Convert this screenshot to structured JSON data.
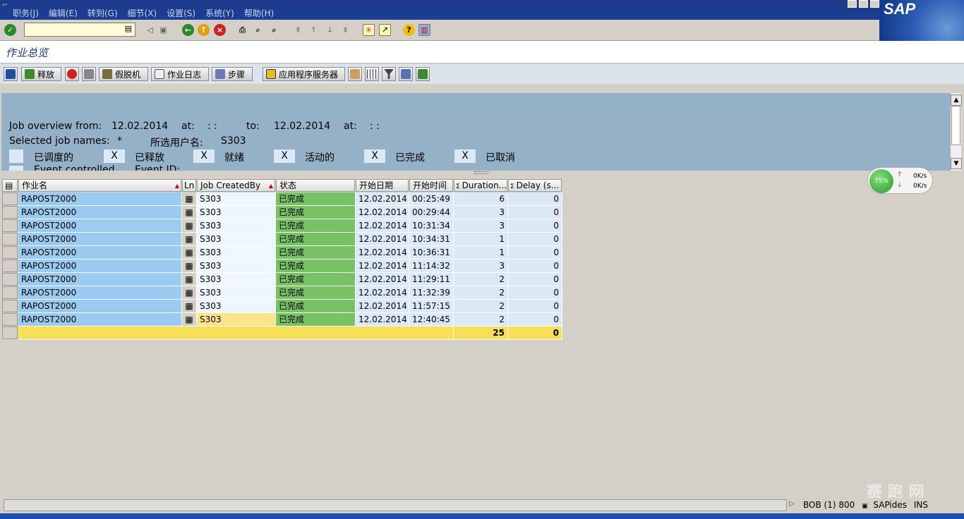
{
  "menu": [
    "职务(J)",
    "编辑(E)",
    "转到(G)",
    "细节(X)",
    "设置(S)",
    "系统(Y)",
    "帮助(H)"
  ],
  "logo_text": "SAP",
  "title": "作业总览",
  "toolbar": {
    "release": "释放",
    "spool": "假脱机",
    "job_log": "作业日志",
    "steps": "步骤",
    "app_server": "应用程序服务器"
  },
  "header": {
    "from_label": "Job overview from:",
    "from_date": "12.02.2014",
    "at1_label": "at:",
    "at1_value": ": :",
    "to_label": "to:",
    "to_date": "12.02.2014",
    "at2_label": "at:",
    "at2_value": ": :",
    "names_label": "Selected job names:",
    "names_value": "*",
    "user_label": "所选用户名:",
    "user_value": "S303",
    "flags": [
      {
        "label": "已调度的",
        "value": ""
      },
      {
        "label": "已释放",
        "value": "X"
      },
      {
        "label": "就绪",
        "value": "X"
      },
      {
        "label": "活动的",
        "value": "X"
      },
      {
        "label": "已完成",
        "value": "X"
      },
      {
        "label": "已取消",
        "value": "X"
      }
    ],
    "event_label": "Event controlled",
    "event_id_label": "Event ID:"
  },
  "columns": [
    "作业名",
    "Ln",
    "Job CreatedBy",
    "状态",
    "开始日期",
    "开始时间",
    "Duration...",
    "Delay (s..."
  ],
  "rows": [
    {
      "name": "RAPOST2000",
      "by": "S303",
      "status": "已完成",
      "date": "12.02.2014",
      "time": "00:25:49",
      "duration": "6",
      "delay": "0"
    },
    {
      "name": "RAPOST2000",
      "by": "S303",
      "status": "已完成",
      "date": "12.02.2014",
      "time": "00:29:44",
      "duration": "3",
      "delay": "0"
    },
    {
      "name": "RAPOST2000",
      "by": "S303",
      "status": "已完成",
      "date": "12.02.2014",
      "time": "10:31:34",
      "duration": "3",
      "delay": "0"
    },
    {
      "name": "RAPOST2000",
      "by": "S303",
      "status": "已完成",
      "date": "12.02.2014",
      "time": "10:34:31",
      "duration": "1",
      "delay": "0"
    },
    {
      "name": "RAPOST2000",
      "by": "S303",
      "status": "已完成",
      "date": "12.02.2014",
      "time": "10:36:31",
      "duration": "1",
      "delay": "0"
    },
    {
      "name": "RAPOST2000",
      "by": "S303",
      "status": "已完成",
      "date": "12.02.2014",
      "time": "11:14:32",
      "duration": "3",
      "delay": "0"
    },
    {
      "name": "RAPOST2000",
      "by": "S303",
      "status": "已完成",
      "date": "12.02.2014",
      "time": "11:29:11",
      "duration": "2",
      "delay": "0"
    },
    {
      "name": "RAPOST2000",
      "by": "S303",
      "status": "已完成",
      "date": "12.02.2014",
      "time": "11:32:39",
      "duration": "2",
      "delay": "0"
    },
    {
      "name": "RAPOST2000",
      "by": "S303",
      "status": "已完成",
      "date": "12.02.2014",
      "time": "11:57:15",
      "duration": "2",
      "delay": "0"
    },
    {
      "name": "RAPOST2000",
      "by": "S303",
      "status": "已完成",
      "date": "12.02.2014",
      "time": "12:40:45",
      "duration": "2",
      "delay": "0"
    }
  ],
  "totals": {
    "duration": "25",
    "delay": "0"
  },
  "net": {
    "percent": "75%",
    "up": "0K/s",
    "down": "0K/s"
  },
  "status": {
    "session": "BOB (1) 800",
    "server": "SAPides",
    "mode": "INS"
  },
  "watermark": "赛 跑 网"
}
